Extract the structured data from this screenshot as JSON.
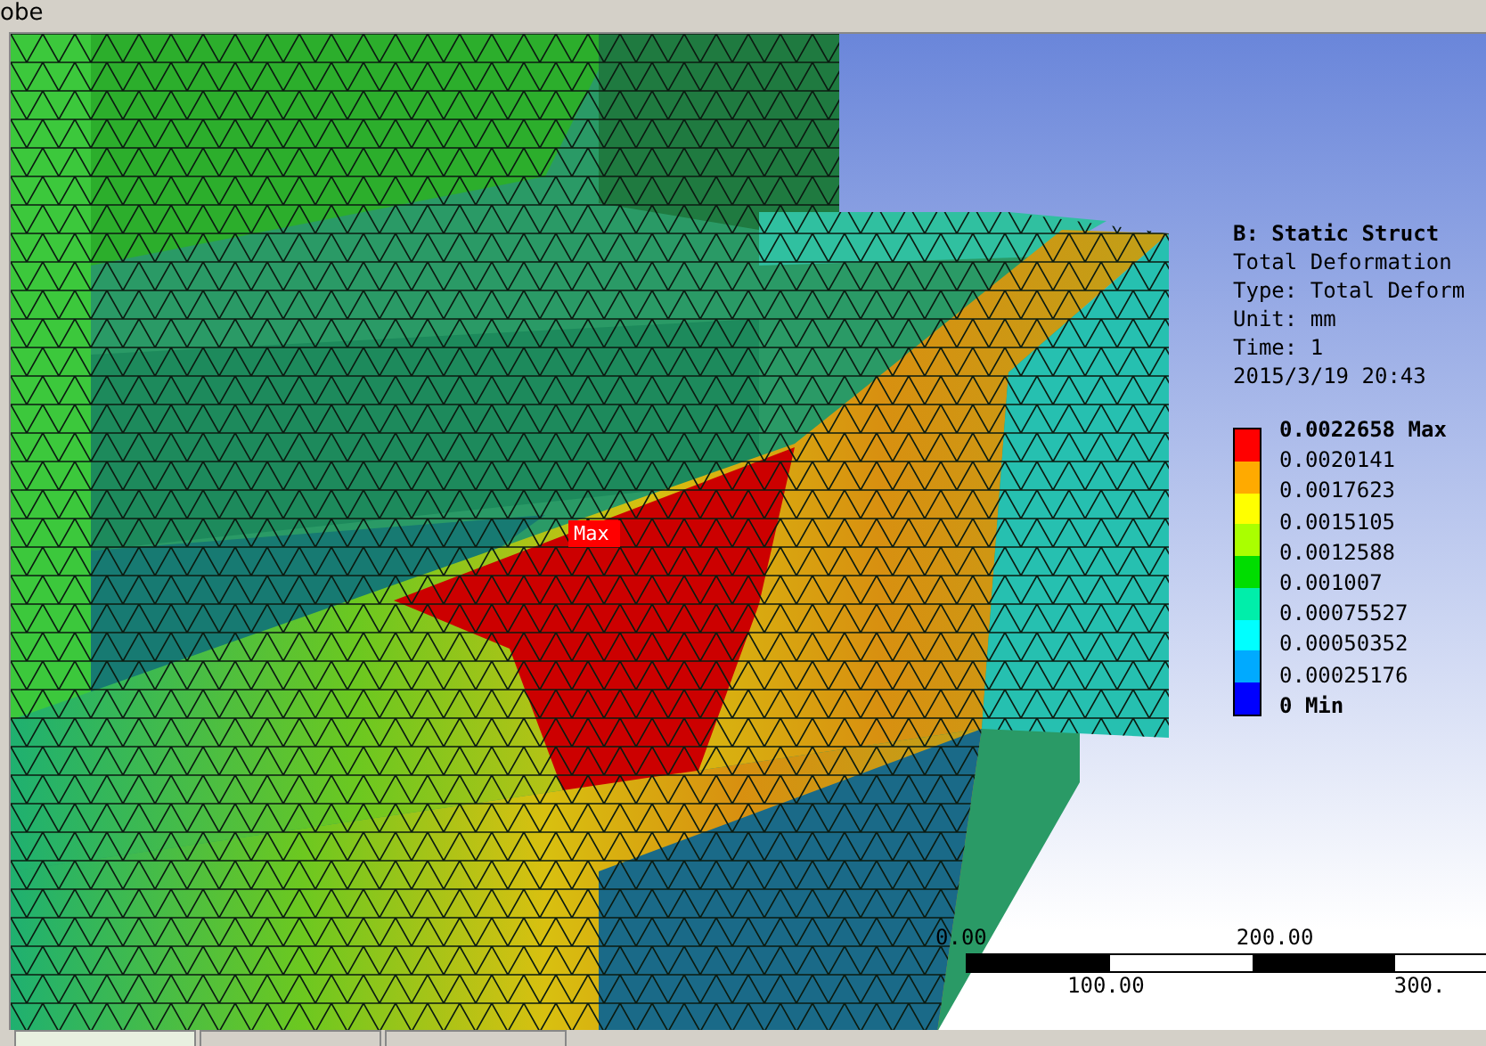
{
  "window": {
    "title": "obe"
  },
  "result": {
    "title": "B: Static Struct",
    "lines": [
      "Total Deformation",
      "Type: Total Deform",
      "Unit: mm",
      "Time: 1",
      "2015/3/19 20:43"
    ]
  },
  "legend": {
    "labels": [
      {
        "text": "0.0022658 Max",
        "kind": "bold"
      },
      {
        "text": "0.0020141",
        "kind": "plain"
      },
      {
        "text": "0.0017623",
        "kind": "plain"
      },
      {
        "text": "0.0015105",
        "kind": "plain"
      },
      {
        "text": "0.0012588",
        "kind": "plain"
      },
      {
        "text": "0.001007",
        "kind": "plain"
      },
      {
        "text": "0.00075527",
        "kind": "plain"
      },
      {
        "text": "0.00050352",
        "kind": "plain"
      },
      {
        "text": "0.00025176",
        "kind": "plain"
      },
      {
        "text": "0 Min",
        "kind": "bold"
      }
    ],
    "bands": [
      {
        "color": "#ff0000"
      },
      {
        "color": "#ffaa00"
      },
      {
        "color": "#ffff00"
      },
      {
        "color": "#aaff00"
      },
      {
        "color": "#00dd00"
      },
      {
        "color": "#00eeaa"
      },
      {
        "color": "#00ffff"
      },
      {
        "color": "#00aaff"
      },
      {
        "color": "#0000ff"
      }
    ]
  },
  "probe_label": "Max",
  "scale": {
    "top_labels": [
      "0.00",
      "200.00"
    ],
    "bottom_labels": [
      "100.00",
      "300."
    ]
  },
  "tabs": [
    {
      "selected": true
    },
    {
      "selected": false
    },
    {
      "selected": false
    }
  ]
}
